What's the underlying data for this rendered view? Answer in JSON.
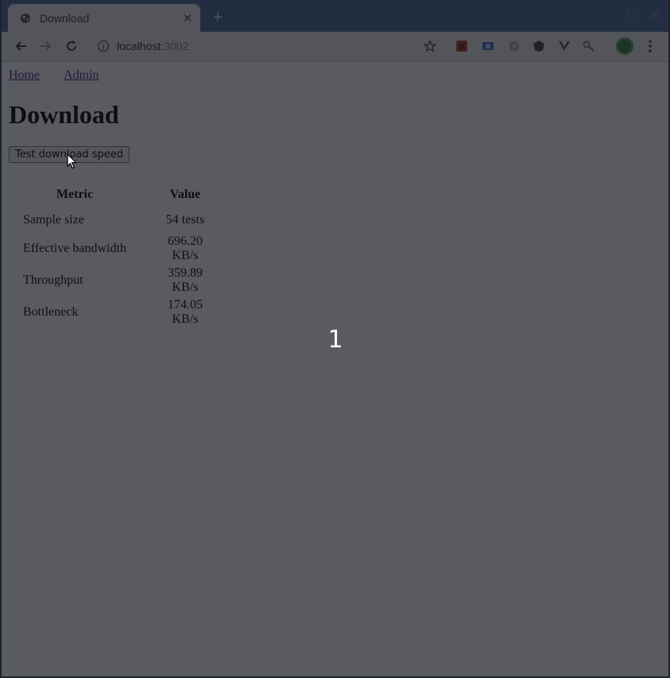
{
  "tab": {
    "title": "Download",
    "close": "✕",
    "new_tab": "+"
  },
  "toolbar": {
    "url_host": "localhost",
    "url_port": ":3002"
  },
  "nav": {
    "home": "Home",
    "admin": "Admin"
  },
  "page": {
    "title": "Download",
    "test_button": "Test download speed"
  },
  "table": {
    "headers": [
      "Metric",
      "Value"
    ],
    "rows": [
      {
        "metric": "Sample size",
        "value": "54 tests"
      },
      {
        "metric": "Effective bandwidth",
        "value": "696.20 KB/s"
      },
      {
        "metric": "Throughput",
        "value": "359.89 KB/s"
      },
      {
        "metric": "Bottleneck",
        "value": "174.05 KB/s"
      }
    ]
  },
  "overlay": {
    "number": "1"
  },
  "colors": {
    "tab_strip": "#4a6690",
    "link": "#551a8b",
    "dim": "#12161e"
  }
}
